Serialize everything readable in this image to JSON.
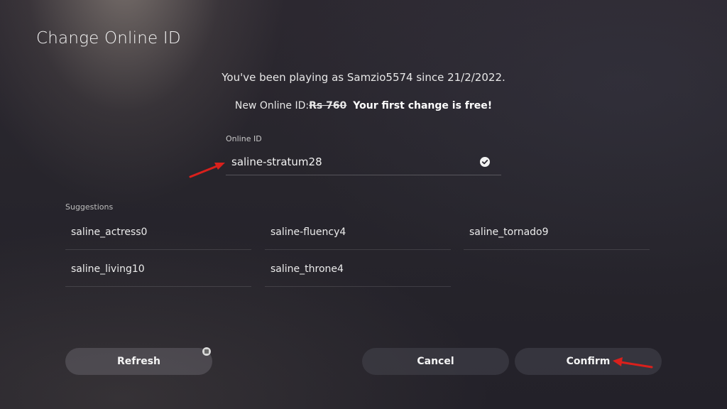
{
  "page": {
    "title": "Change Online ID"
  },
  "info": {
    "playing_since": "You've been playing as Samzio5574 since 21/2/2022.",
    "new_id_prefix": "New Online ID:",
    "price": "Rs 760",
    "free_text": "Your first change is free!"
  },
  "online_id": {
    "label": "Online ID",
    "value": "saline-stratum28",
    "valid_icon": "check-circle-icon"
  },
  "suggestions": {
    "label": "Suggestions",
    "items": [
      "saline_actress0",
      "saline-fluency4",
      "saline_tornado9",
      "saline_living10",
      "saline_throne4"
    ]
  },
  "buttons": {
    "refresh": "Refresh",
    "cancel": "Cancel",
    "confirm": "Confirm"
  },
  "annotations": {
    "arrow_color": "#d9201c"
  }
}
